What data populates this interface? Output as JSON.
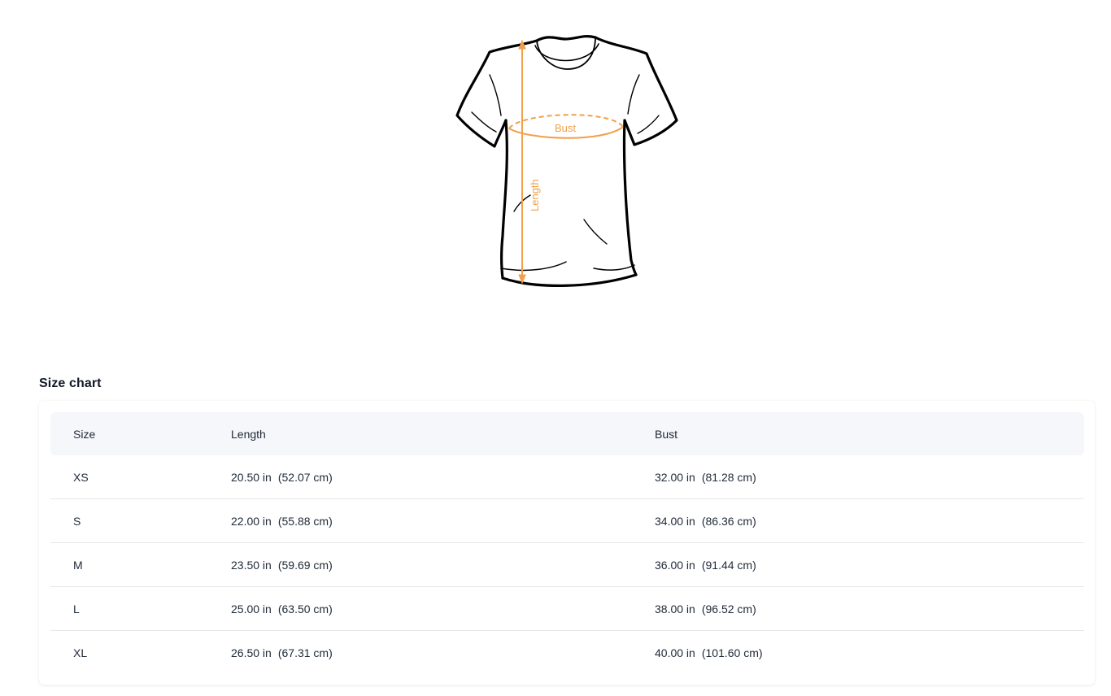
{
  "illustration": {
    "labels": {
      "bust": "Bust",
      "length": "Length"
    },
    "accent_color": "#f0a04b"
  },
  "size_chart": {
    "title": "Size chart",
    "headers": {
      "size": "Size",
      "length": "Length",
      "bust": "Bust"
    },
    "rows": [
      {
        "size": "XS",
        "length_in": "20.50 in",
        "length_cm": "(52.07 cm)",
        "bust_in": "32.00 in",
        "bust_cm": "(81.28 cm)"
      },
      {
        "size": "S",
        "length_in": "22.00 in",
        "length_cm": "(55.88 cm)",
        "bust_in": "34.00 in",
        "bust_cm": "(86.36 cm)"
      },
      {
        "size": "M",
        "length_in": "23.50 in",
        "length_cm": "(59.69 cm)",
        "bust_in": "36.00 in",
        "bust_cm": "(91.44 cm)"
      },
      {
        "size": "L",
        "length_in": "25.00 in",
        "length_cm": "(63.50 cm)",
        "bust_in": "38.00 in",
        "bust_cm": "(96.52 cm)"
      },
      {
        "size": "XL",
        "length_in": "26.50 in",
        "length_cm": "(67.31 cm)",
        "bust_in": "40.00 in",
        "bust_cm": "(101.60 cm)"
      }
    ]
  }
}
